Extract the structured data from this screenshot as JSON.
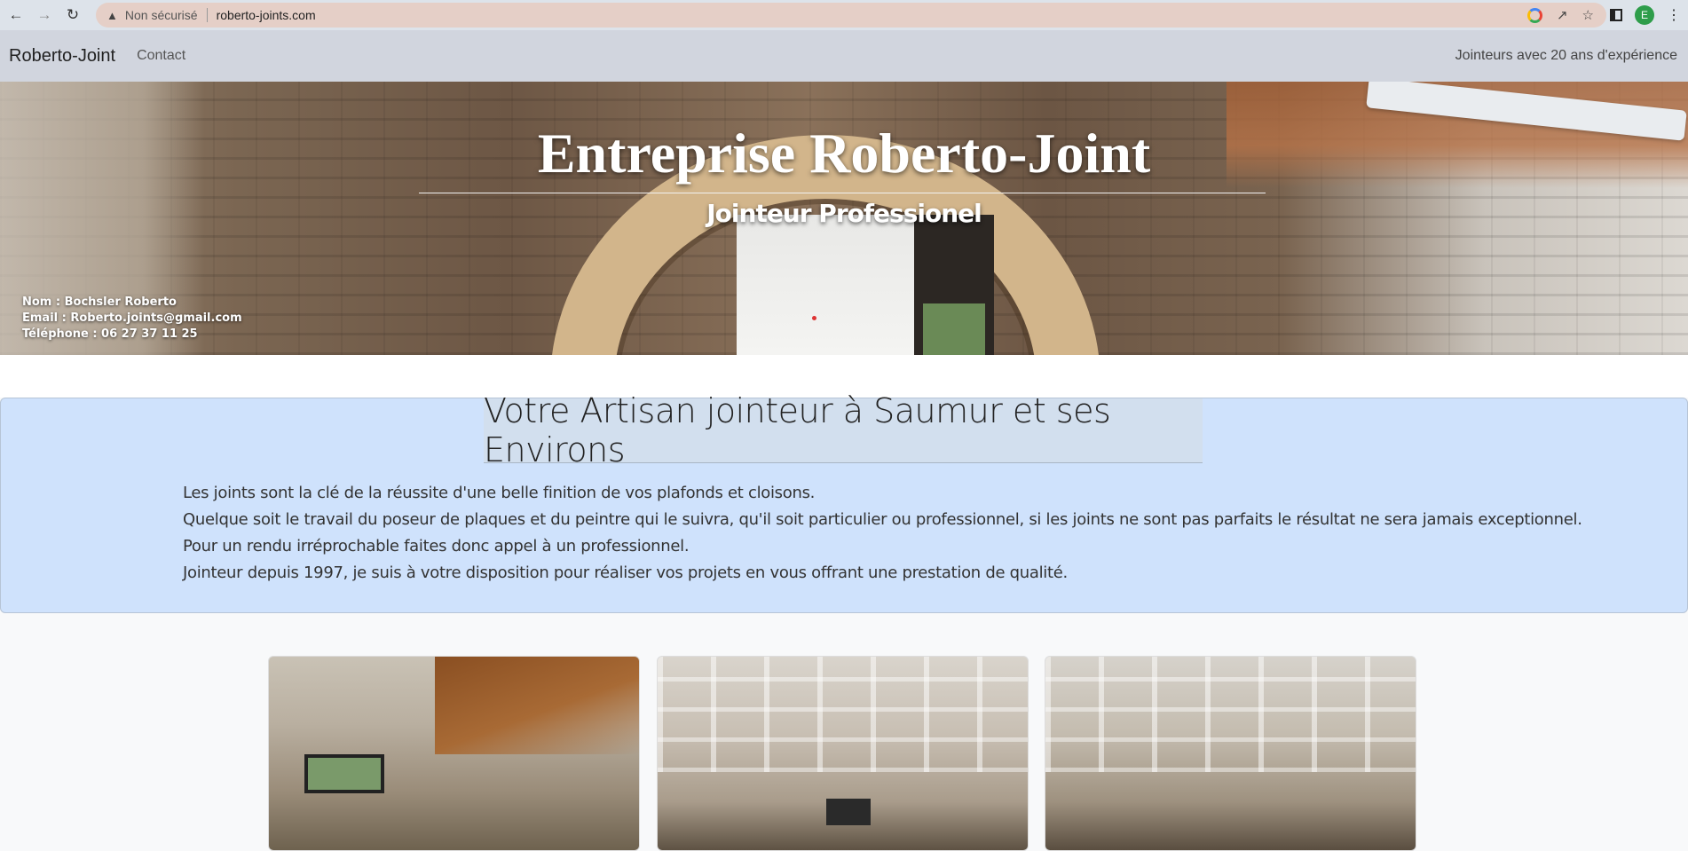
{
  "browser": {
    "security_label": "Non sécurisé",
    "url": "roberto-joints.com",
    "profile_initial": "E"
  },
  "navbar": {
    "brand": "Roberto-Joint",
    "link_contact": "Contact",
    "tagline": "Jointeurs avec 20 ans d'expérience"
  },
  "hero": {
    "title": "Entreprise Roberto-Joint",
    "subtitle": "Jointeur Professionel",
    "contact_name": "Nom : Bochsler Roberto",
    "contact_email": "Email : Roberto.joints@gmail.com",
    "contact_phone": "Téléphone : 06 27 37 11 25"
  },
  "intro": {
    "heading": "Votre Artisan jointeur à Saumur et ses Environs",
    "paragraphs": [
      "Les joints sont la clé de la réussite d'une belle finition de vos plafonds et cloisons.",
      "Quelque soit le travail du poseur de plaques et du peintre qui le suivra, qu'il soit particulier ou professionnel, si les joints ne sont pas parfaits le résultat ne sera jamais exceptionnel.",
      "Pour un rendu irréprochable faites donc appel à un professionnel.",
      "Jointeur depuis 1997, je suis à votre disposition pour réaliser vos projets en vous offrant une prestation de qualité."
    ]
  },
  "icons": {
    "back": "arrow-left-icon",
    "forward": "arrow-right-icon",
    "reload": "reload-icon",
    "warning": "warning-icon",
    "google": "google-icon",
    "share": "share-icon",
    "bookmark": "star-icon",
    "sidepanel": "side-panel-icon",
    "menu": "kebab-menu-icon"
  },
  "colors": {
    "navbar_bg": "#d1d5de",
    "intro_bg": "#cfe2fc",
    "omnibox_bg": "#e5cfc7"
  }
}
